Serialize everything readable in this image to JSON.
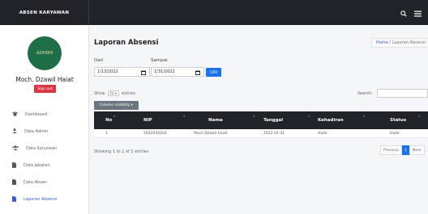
{
  "app": {
    "brand": "ABSEN KARYAWAN"
  },
  "user": {
    "avatar_text": "ADMIN",
    "name": "Moch. Dzawil Haiat",
    "signout_label": "Sign out"
  },
  "sidebar": {
    "items": [
      {
        "label": "Dashboard",
        "icon": "palette-icon"
      },
      {
        "label": "Data Admin",
        "icon": "user-icon"
      },
      {
        "label": "Data Karyawan",
        "icon": "users-icon"
      },
      {
        "label": "Data Jabatan",
        "icon": "file-icon"
      },
      {
        "label": "Data Absen",
        "icon": "file-icon"
      },
      {
        "label": "Laporan Absensi",
        "icon": "report-icon"
      }
    ]
  },
  "page": {
    "title": "Laporan Absensi",
    "breadcrumb_home": "Home",
    "breadcrumb_sep": " / ",
    "breadcrumb_current": "Laporan Absensi"
  },
  "filter": {
    "dari_label": "Dari",
    "sampai_label": "Sampai",
    "dari_value": "1/13/2022",
    "sampai_value": "1/31/2022",
    "cari_label": "CARI"
  },
  "table": {
    "show_prefix": "Show",
    "show_value": "10",
    "show_suffix": "entries",
    "search_label": "Search:",
    "colvis_label": "Column visibility",
    "headers": [
      "No",
      "NIP",
      "Nama",
      "Tanggal",
      "Kehadiran",
      "Status"
    ],
    "rows": [
      [
        "1",
        "2022032024",
        "Moch Dzawil Haiat",
        "2022-01-31",
        "Hadir",
        "Hadir"
      ]
    ],
    "info": "Showing 1 to 1 of 1 entries",
    "pager": {
      "previous": "Previous",
      "current": "1",
      "next": "Next"
    }
  },
  "colors": {
    "topbar": "#222229",
    "accent": "#1a73e8",
    "danger": "#dc3545",
    "avatar": "#1e6e48"
  }
}
